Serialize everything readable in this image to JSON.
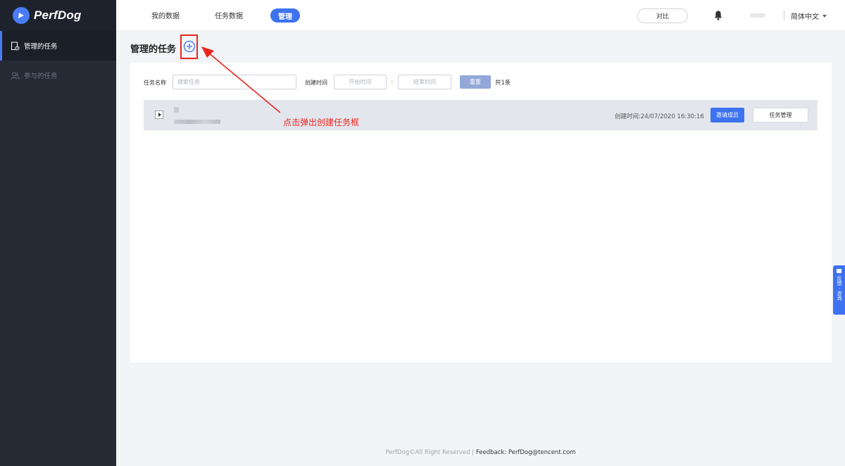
{
  "app": {
    "logo_text": "PerfDog"
  },
  "sidebar": {
    "items": [
      {
        "label": "管理的任务",
        "active": true
      },
      {
        "label": "参与的任务",
        "active": false
      }
    ]
  },
  "topnav": {
    "items": [
      "我的数据",
      "任务数据"
    ],
    "active_label": "管理",
    "compare_label": "对比",
    "language_label": "简体中文"
  },
  "page": {
    "title": "管理的任务"
  },
  "filters": {
    "task_name_label": "任务名称",
    "task_name_placeholder": "搜索任务",
    "created_time_label": "创建时间",
    "start_placeholder": "开始时间",
    "range_separator": "-",
    "end_placeholder": "结束时间",
    "reset_label": "重置",
    "total_text": "共1条"
  },
  "tasks": [
    {
      "created_text": "创建时间:24/07/2020 16:30:16",
      "invite_label": "邀请成员",
      "manage_label": "任务管理"
    }
  ],
  "annotation": {
    "text": "点击弹出创建任务框",
    "color": "#e8261f"
  },
  "float_tab": {
    "label": "反馈 · 咨询"
  },
  "footer": {
    "copyright": "PerfDog©All Right Reserved",
    "separator": " | ",
    "feedback": "Feedback: PerfDog@tencent.com"
  },
  "colors": {
    "accent": "#3d72f0",
    "sidebar_bg": "#262a35",
    "row_bg": "#e4e6ed"
  }
}
